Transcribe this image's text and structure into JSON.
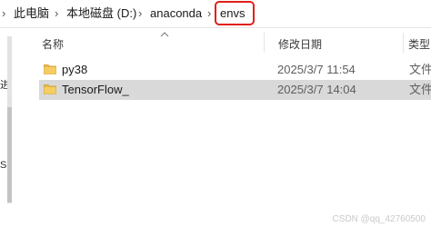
{
  "breadcrumb": {
    "items": [
      "此电脑",
      "本地磁盘 (D:)",
      "anaconda",
      "envs"
    ],
    "separator": "›",
    "highlight_color": "#e0201a"
  },
  "columns": {
    "name": "名称",
    "date_modified": "修改日期",
    "type": "类型"
  },
  "rows": [
    {
      "name": "py38",
      "date": "2025/3/7 11:54",
      "type": "文件",
      "selected": false
    },
    {
      "name": "TensorFlow_",
      "date": "2025/3/7 14:04",
      "type": "文件",
      "selected": true
    }
  ],
  "nav": {
    "fragments": [
      "进",
      "SO"
    ]
  },
  "watermark": "CSDN @qq_42760500",
  "colors": {
    "folder": "#e8b84a",
    "selection": "#d9d9d9"
  }
}
